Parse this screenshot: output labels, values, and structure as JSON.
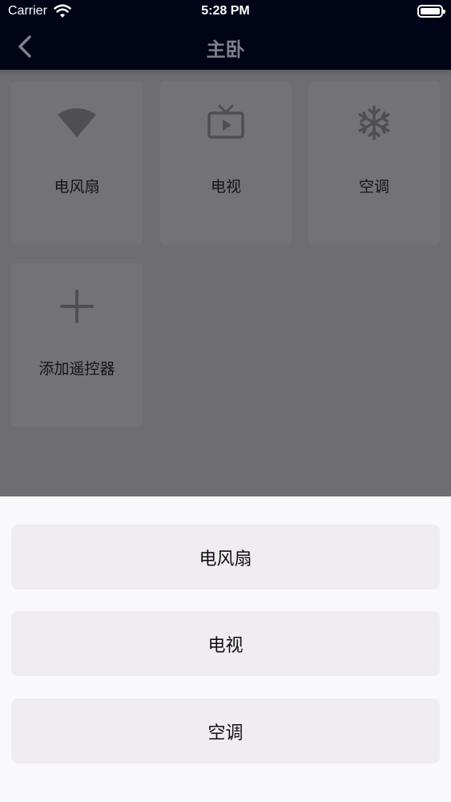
{
  "status_bar": {
    "carrier": "Carrier",
    "time": "5:28 PM",
    "icons": [
      "wifi-icon",
      "battery-icon"
    ]
  },
  "nav": {
    "title": "主卧",
    "back_icon": "chevron-left-icon"
  },
  "devices": [
    {
      "label": "电风扇",
      "icon": "fan-icon"
    },
    {
      "label": "电视",
      "icon": "tv-icon"
    },
    {
      "label": "空调",
      "icon": "snowflake-icon"
    },
    {
      "label": "添加遥控器",
      "icon": "plus-icon"
    }
  ],
  "action_sheet": {
    "options": [
      {
        "label": "电风扇"
      },
      {
        "label": "电视"
      },
      {
        "label": "空调"
      }
    ]
  },
  "colors": {
    "nav_background": "#010417",
    "overlay_background": "#6e6d70",
    "tile_background": "#737275",
    "icon_color": "#4f4e51",
    "sheet_background": "#f9f9fb",
    "sheet_button": "#efedf0"
  }
}
